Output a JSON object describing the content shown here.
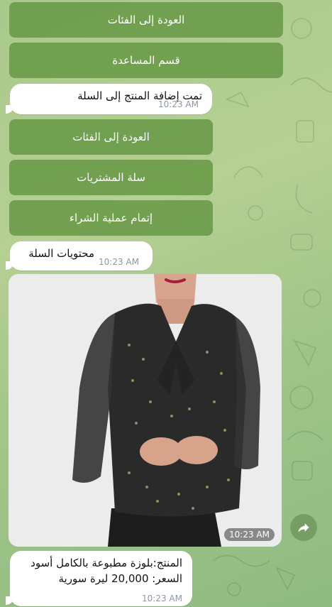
{
  "keyboard_top": {
    "back_to_categories": "العودة إلى الفئات",
    "help_section": "قسم المساعدة"
  },
  "message_added": {
    "text": "تمت إضافة المنتج إلى السلة",
    "time": "10:23 AM"
  },
  "keyboard_cart": {
    "back_to_categories": "العودة إلى الفئات",
    "shopping_cart": "سلة المشتريات",
    "checkout": "إتمام عملية الشراء"
  },
  "message_cart": {
    "text": "محتويات السلة",
    "time": "10:23 AM"
  },
  "photo_message": {
    "time": "10:23 AM"
  },
  "product_caption": {
    "product_line": "المنتج:بلوزة مطبوعة بالكامل أسود",
    "price_line": "السعر: 20,000 ليرة سورية",
    "time": "10:23 AM"
  },
  "icons": {
    "forward": "forward-arrow-icon"
  },
  "colors": {
    "keyboard_button": "#639642",
    "bubble": "#ffffff",
    "timestamp": "#8d98a3"
  }
}
